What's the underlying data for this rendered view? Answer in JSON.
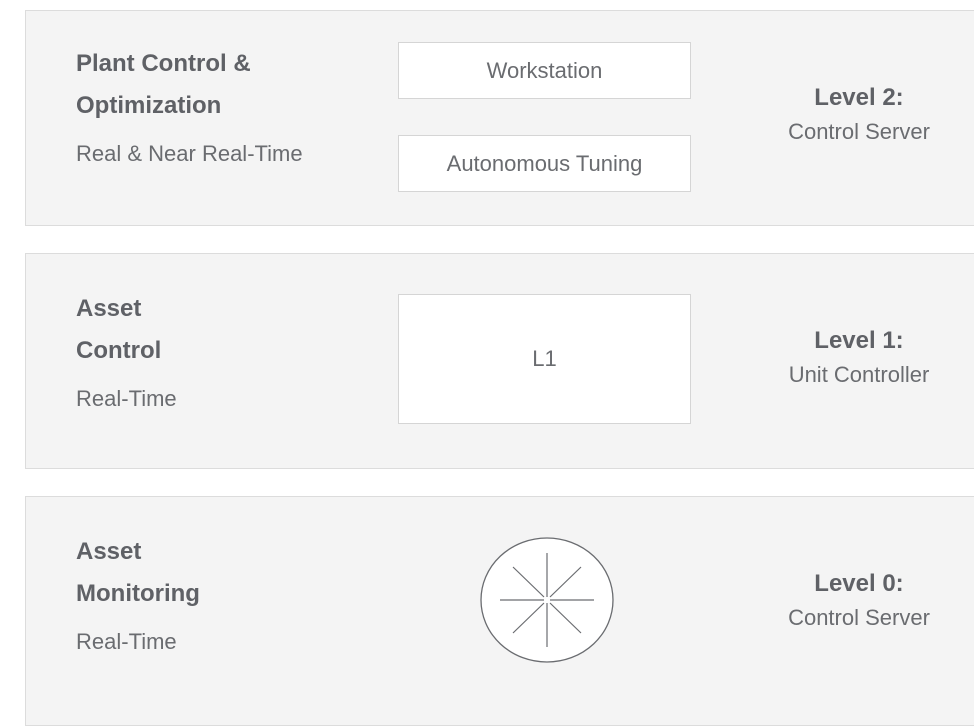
{
  "tiers": [
    {
      "title_line1": "Plant Control &",
      "title_line2": "Optimization",
      "subtitle": "Real & Near Real-Time",
      "boxes": [
        "Workstation",
        "Autonomous Tuning"
      ],
      "level_title": "Level 2:",
      "level_subtitle": "Control Server"
    },
    {
      "title_line1": "Asset",
      "title_line2": "Control",
      "subtitle": "Real-Time",
      "boxes": [
        "L1"
      ],
      "level_title": "Level 1:",
      "level_subtitle": "Unit Controller"
    },
    {
      "title_line1": "Asset",
      "title_line2": "Monitoring",
      "subtitle": "Real-Time",
      "icon": "sensor-icon",
      "level_title": "Level 0:",
      "level_subtitle": "Control Server"
    }
  ],
  "colors": {
    "panel_background": "#f4f4f4",
    "panel_border": "#dcdcdc",
    "text": "#5f6166",
    "box_background": "#ffffff"
  }
}
